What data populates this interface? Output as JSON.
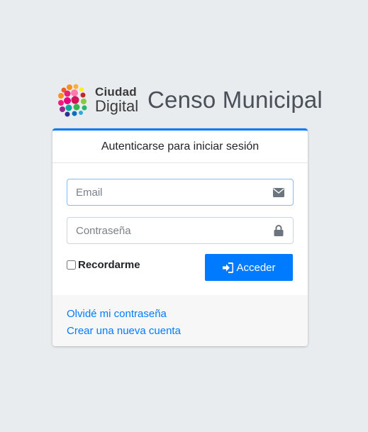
{
  "brand": {
    "logo_top": "Ciudad",
    "logo_bottom": "Digital",
    "title": "Censo Municipal",
    "logo_colors": [
      "#f7931e",
      "#e6007e",
      "#8dc63f",
      "#00a99d",
      "#2e3192"
    ]
  },
  "card": {
    "header": "Autenticarse para iniciar sesión",
    "email": {
      "value": "",
      "placeholder": "Email",
      "icon": "envelope-icon"
    },
    "password": {
      "value": "",
      "placeholder": "Contraseña",
      "icon": "lock-icon"
    },
    "remember_label": "Recordarme",
    "remember_checked": false,
    "submit_label": "Acceder",
    "submit_icon": "sign-in-icon",
    "accent_color": "#007bff"
  },
  "links": {
    "forgot": "Olvidé mi contraseña",
    "register": "Crear una nueva cuenta"
  }
}
